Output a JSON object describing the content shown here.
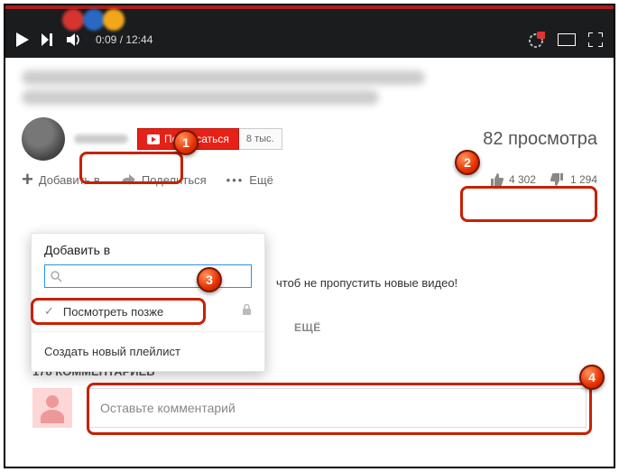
{
  "player": {
    "time_current": "0:09",
    "time_total": "12:44"
  },
  "channel": {
    "subscribe_label": "Подписаться",
    "subscriber_count": "8 тыс."
  },
  "views": "82 просмотра",
  "actions": {
    "add_to": "Добавить в",
    "share": "Поделиться",
    "more": "Ещё"
  },
  "likes": {
    "up": "4 302",
    "down": "1 294"
  },
  "dropdown": {
    "title": "Добавить в",
    "search_placeholder": "",
    "watch_later": "Посмотреть позже",
    "create": "Создать новый плейлист"
  },
  "description": {
    "line": "чтоб не пропустить новые видео!",
    "more": "ЕЩЁ"
  },
  "comments": {
    "count_label": "178 КОММЕНТАРИЕВ",
    "placeholder": "Оставьте комментарий"
  },
  "callouts": {
    "n1": "1",
    "n2": "2",
    "n3": "3",
    "n4": "4"
  }
}
